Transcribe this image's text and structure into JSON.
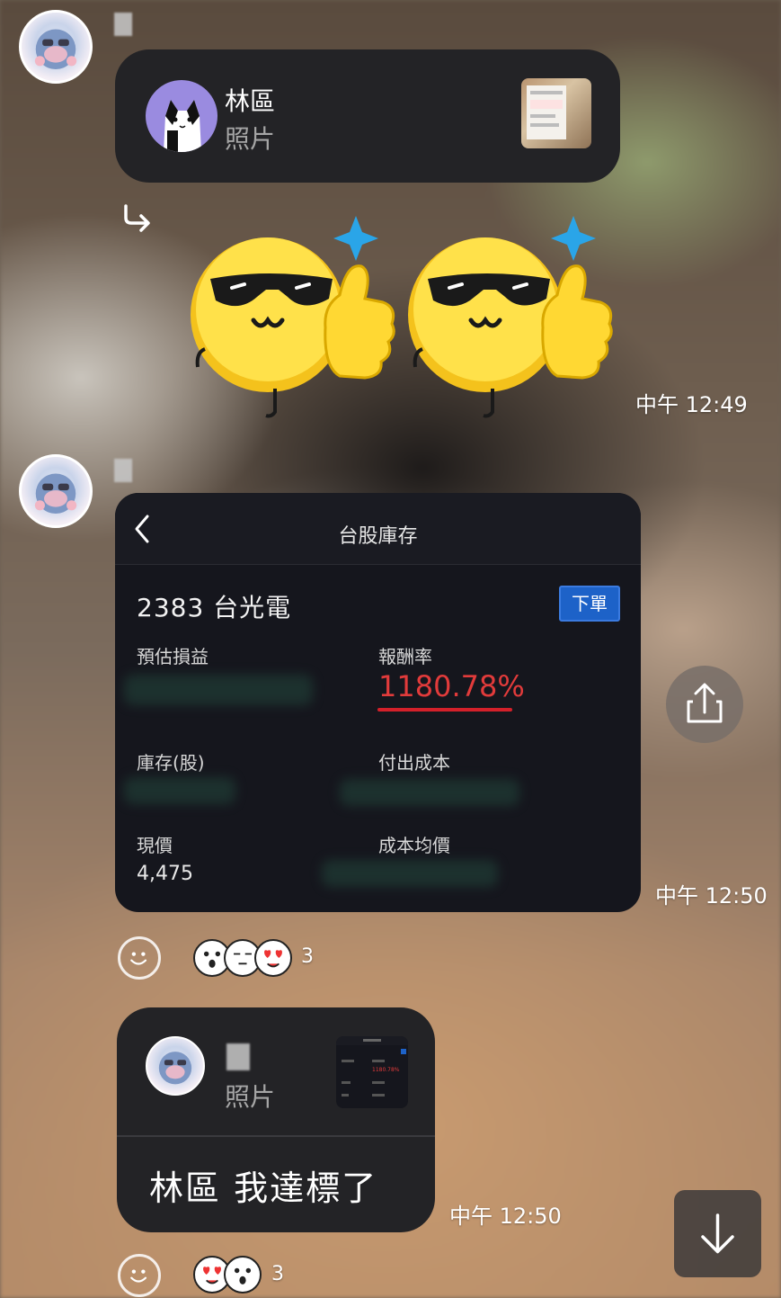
{
  "messages": {
    "reply_card_1": {
      "name": "林區",
      "subtitle": "照片"
    },
    "time_1": "中午 12:49",
    "stock_card": {
      "title": "台股庫存",
      "stock_name": "2383 台光電",
      "order_button": "下單",
      "est_pnl_label": "預估損益",
      "return_label": "報酬率",
      "return_value": "1180.78%",
      "holdings_label": "庫存(股)",
      "paid_cost_label": "付出成本",
      "price_label": "現價",
      "price_value": "4,475",
      "avg_cost_label": "成本均價"
    },
    "time_2": "中午 12:50",
    "reactions_1": {
      "count": "3"
    },
    "reply_card_2": {
      "subtitle": "照片",
      "message": "林區  我達標了",
      "thumb_return": "1180.78%"
    },
    "time_3": "中午 12:50",
    "reactions_2": {
      "count": "3"
    }
  },
  "icons": {
    "reply_arrow": "reply-arrow-icon",
    "back": "chevron-left-icon",
    "share": "share-icon",
    "smile": "smile-icon",
    "scroll_down": "arrow-down-icon"
  },
  "colors": {
    "return_red": "#e23b3b",
    "order_blue": "#1d62c8",
    "bubble_dark": "#232326",
    "sparkle_blue": "#2aa5e8"
  }
}
